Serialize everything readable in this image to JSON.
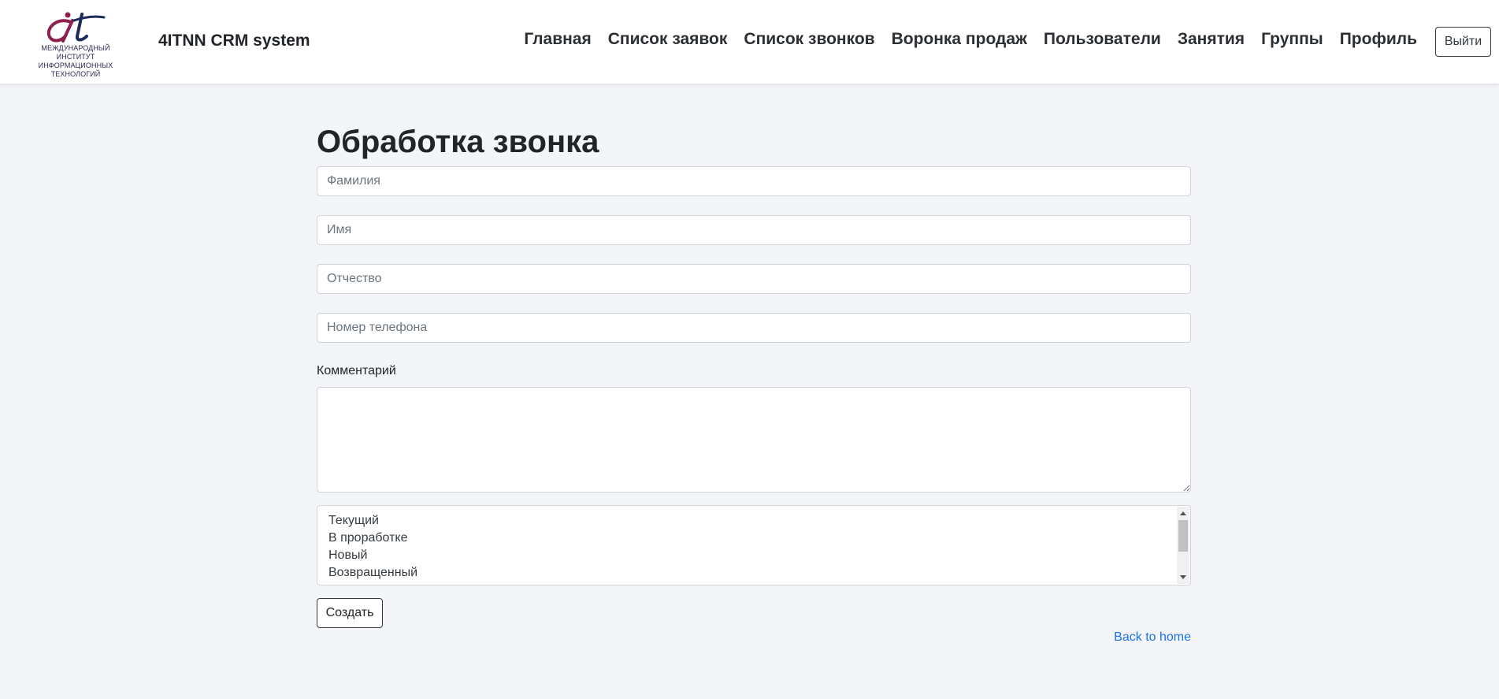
{
  "header": {
    "logo_lines": [
      "МЕЖДУНАРОДНЫЙ ИНСТИТУТ",
      "ИНФОРМАЦИОННЫХ",
      "ТЕХНОЛОГИЙ"
    ],
    "brand": "4ITNN CRM system",
    "nav": [
      "Главная",
      "Список заявок",
      "Список звонков",
      "Воронка продаж",
      "Пользователи",
      "Занятия",
      "Группы",
      "Профиль"
    ],
    "logout": "Выйти"
  },
  "form": {
    "title": "Обработка звонка",
    "lastname_placeholder": "Фамилия",
    "firstname_placeholder": "Имя",
    "patronymic_placeholder": "Отчество",
    "phone_placeholder": "Номер телефона",
    "comment_label": "Комментарий",
    "comment_value": "",
    "status_options": [
      "Текущий",
      "В проработке",
      "Новый",
      "Возвращенный"
    ],
    "submit": "Создать",
    "back_link": "Back to home"
  },
  "colors": {
    "background": "#f4f5f8",
    "link": "#1a73e8",
    "logo_magenta": "#8e1f4f",
    "logo_navy": "#1d2b5a"
  }
}
